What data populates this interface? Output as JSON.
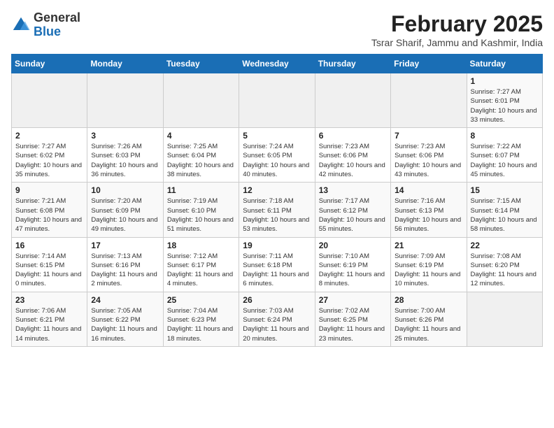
{
  "header": {
    "logo": {
      "general": "General",
      "blue": "Blue"
    },
    "title": "February 2025",
    "subtitle": "Tsrar Sharif, Jammu and Kashmir, India"
  },
  "calendar": {
    "weekdays": [
      "Sunday",
      "Monday",
      "Tuesday",
      "Wednesday",
      "Thursday",
      "Friday",
      "Saturday"
    ],
    "weeks": [
      [
        {
          "day": "",
          "info": ""
        },
        {
          "day": "",
          "info": ""
        },
        {
          "day": "",
          "info": ""
        },
        {
          "day": "",
          "info": ""
        },
        {
          "day": "",
          "info": ""
        },
        {
          "day": "",
          "info": ""
        },
        {
          "day": "1",
          "info": "Sunrise: 7:27 AM\nSunset: 6:01 PM\nDaylight: 10 hours and 33 minutes."
        }
      ],
      [
        {
          "day": "2",
          "info": "Sunrise: 7:27 AM\nSunset: 6:02 PM\nDaylight: 10 hours and 35 minutes."
        },
        {
          "day": "3",
          "info": "Sunrise: 7:26 AM\nSunset: 6:03 PM\nDaylight: 10 hours and 36 minutes."
        },
        {
          "day": "4",
          "info": "Sunrise: 7:25 AM\nSunset: 6:04 PM\nDaylight: 10 hours and 38 minutes."
        },
        {
          "day": "5",
          "info": "Sunrise: 7:24 AM\nSunset: 6:05 PM\nDaylight: 10 hours and 40 minutes."
        },
        {
          "day": "6",
          "info": "Sunrise: 7:23 AM\nSunset: 6:06 PM\nDaylight: 10 hours and 42 minutes."
        },
        {
          "day": "7",
          "info": "Sunrise: 7:23 AM\nSunset: 6:06 PM\nDaylight: 10 hours and 43 minutes."
        },
        {
          "day": "8",
          "info": "Sunrise: 7:22 AM\nSunset: 6:07 PM\nDaylight: 10 hours and 45 minutes."
        }
      ],
      [
        {
          "day": "9",
          "info": "Sunrise: 7:21 AM\nSunset: 6:08 PM\nDaylight: 10 hours and 47 minutes."
        },
        {
          "day": "10",
          "info": "Sunrise: 7:20 AM\nSunset: 6:09 PM\nDaylight: 10 hours and 49 minutes."
        },
        {
          "day": "11",
          "info": "Sunrise: 7:19 AM\nSunset: 6:10 PM\nDaylight: 10 hours and 51 minutes."
        },
        {
          "day": "12",
          "info": "Sunrise: 7:18 AM\nSunset: 6:11 PM\nDaylight: 10 hours and 53 minutes."
        },
        {
          "day": "13",
          "info": "Sunrise: 7:17 AM\nSunset: 6:12 PM\nDaylight: 10 hours and 55 minutes."
        },
        {
          "day": "14",
          "info": "Sunrise: 7:16 AM\nSunset: 6:13 PM\nDaylight: 10 hours and 56 minutes."
        },
        {
          "day": "15",
          "info": "Sunrise: 7:15 AM\nSunset: 6:14 PM\nDaylight: 10 hours and 58 minutes."
        }
      ],
      [
        {
          "day": "16",
          "info": "Sunrise: 7:14 AM\nSunset: 6:15 PM\nDaylight: 11 hours and 0 minutes."
        },
        {
          "day": "17",
          "info": "Sunrise: 7:13 AM\nSunset: 6:16 PM\nDaylight: 11 hours and 2 minutes."
        },
        {
          "day": "18",
          "info": "Sunrise: 7:12 AM\nSunset: 6:17 PM\nDaylight: 11 hours and 4 minutes."
        },
        {
          "day": "19",
          "info": "Sunrise: 7:11 AM\nSunset: 6:18 PM\nDaylight: 11 hours and 6 minutes."
        },
        {
          "day": "20",
          "info": "Sunrise: 7:10 AM\nSunset: 6:19 PM\nDaylight: 11 hours and 8 minutes."
        },
        {
          "day": "21",
          "info": "Sunrise: 7:09 AM\nSunset: 6:19 PM\nDaylight: 11 hours and 10 minutes."
        },
        {
          "day": "22",
          "info": "Sunrise: 7:08 AM\nSunset: 6:20 PM\nDaylight: 11 hours and 12 minutes."
        }
      ],
      [
        {
          "day": "23",
          "info": "Sunrise: 7:06 AM\nSunset: 6:21 PM\nDaylight: 11 hours and 14 minutes."
        },
        {
          "day": "24",
          "info": "Sunrise: 7:05 AM\nSunset: 6:22 PM\nDaylight: 11 hours and 16 minutes."
        },
        {
          "day": "25",
          "info": "Sunrise: 7:04 AM\nSunset: 6:23 PM\nDaylight: 11 hours and 18 minutes."
        },
        {
          "day": "26",
          "info": "Sunrise: 7:03 AM\nSunset: 6:24 PM\nDaylight: 11 hours and 20 minutes."
        },
        {
          "day": "27",
          "info": "Sunrise: 7:02 AM\nSunset: 6:25 PM\nDaylight: 11 hours and 23 minutes."
        },
        {
          "day": "28",
          "info": "Sunrise: 7:00 AM\nSunset: 6:26 PM\nDaylight: 11 hours and 25 minutes."
        },
        {
          "day": "",
          "info": ""
        }
      ]
    ]
  }
}
